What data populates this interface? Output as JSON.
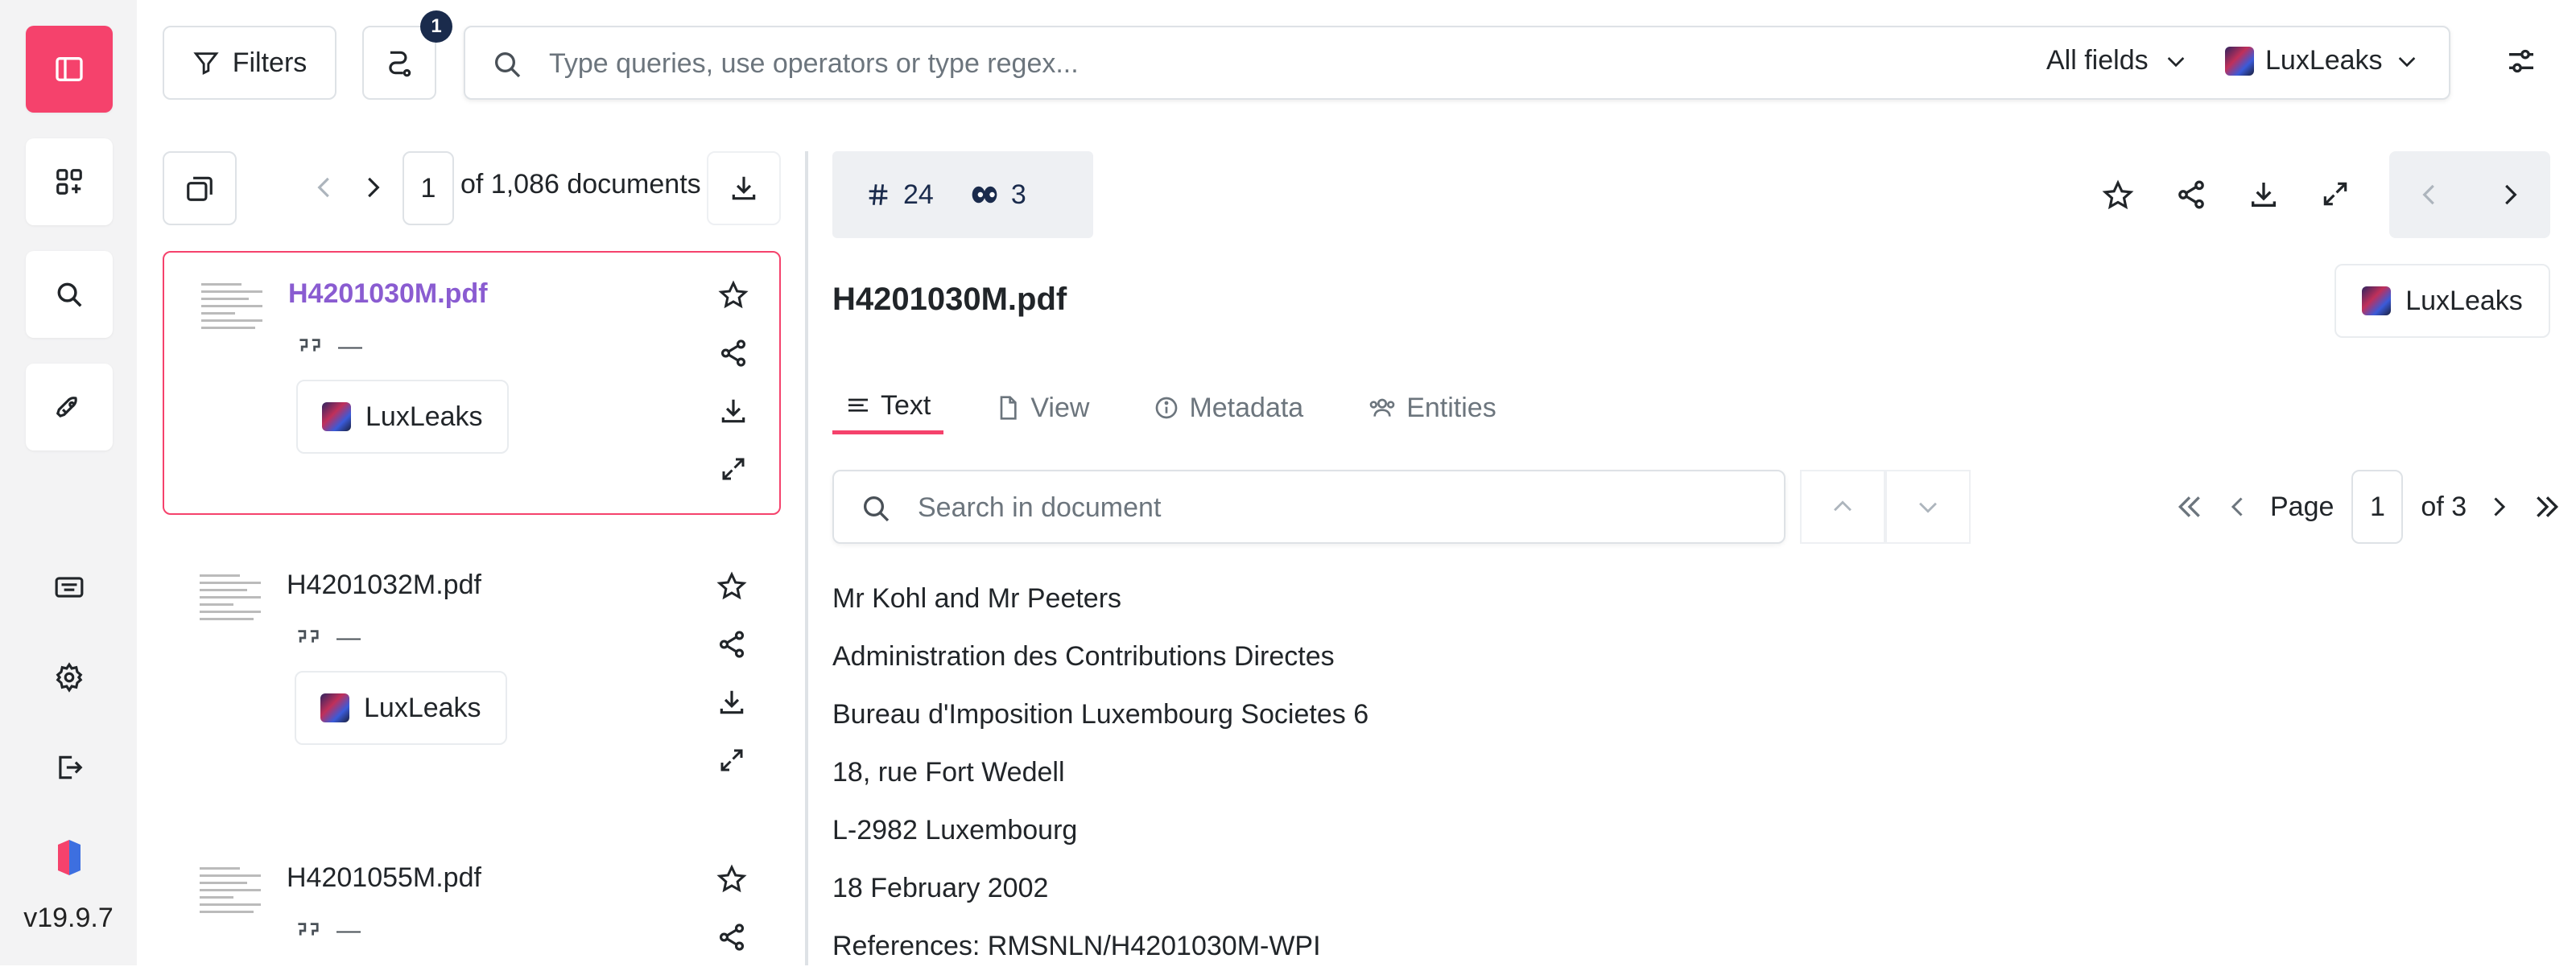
{
  "app": {
    "version": "v19.9.7"
  },
  "toolbar": {
    "filters_label": "Filters",
    "badge_count": "1",
    "search_placeholder": "Type queries, use operators or type regex...",
    "fields_label": "All fields",
    "project_label": "LuxLeaks"
  },
  "list": {
    "page_value": "1",
    "of_label": "of 1,086 documents",
    "items": [
      {
        "name": "H4201030M.pdf",
        "quote": "—",
        "project": "LuxLeaks"
      },
      {
        "name": "H4201032M.pdf",
        "quote": "—",
        "project": "LuxLeaks"
      },
      {
        "name": "H4201055M.pdf",
        "quote": "—",
        "project": "LuxLeaks"
      }
    ]
  },
  "doc": {
    "stats": {
      "id": "24",
      "views": "3"
    },
    "title": "H4201030M.pdf",
    "project": "LuxLeaks",
    "tabs": [
      "Text",
      "View",
      "Metadata",
      "Entities"
    ],
    "search_placeholder": "Search in document",
    "pager": {
      "page_label": "Page",
      "page_value": "1",
      "of_label": "of 3"
    },
    "lines": [
      "Mr Kohl and Mr Peeters",
      "Administration des Contributions Directes",
      "Bureau d'Imposition Luxembourg Societes 6",
      "18, rue Fort Wedell",
      "L-2982 Luxembourg",
      "18 February 2002",
      "References: RMSNLN/H4201030M-WPI"
    ]
  },
  "colors": {
    "accent": "#f5426c",
    "selected_name": "#8a5cd1",
    "navy": "#1a2b4c"
  }
}
